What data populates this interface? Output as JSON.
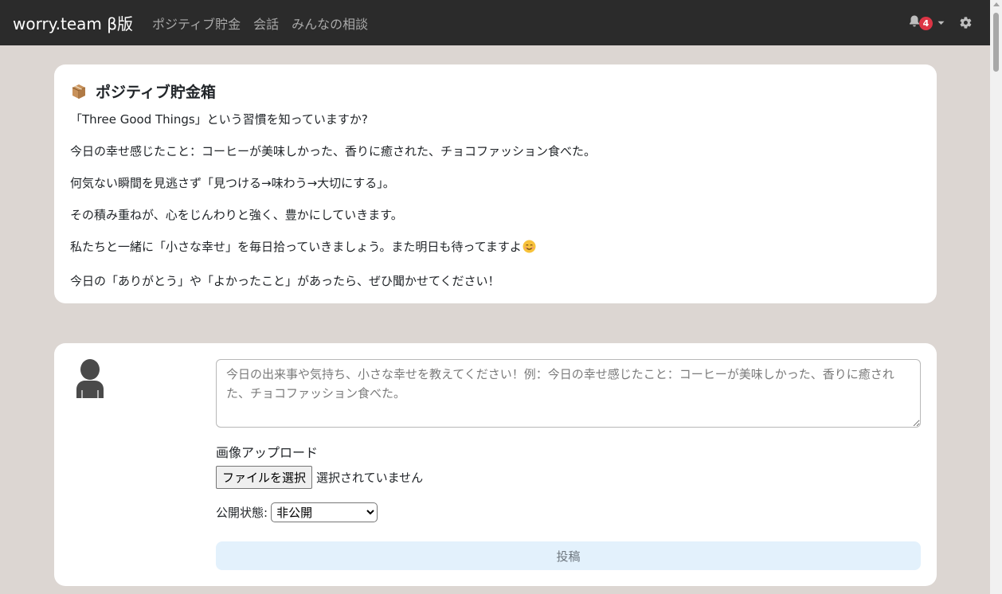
{
  "navbar": {
    "brand": "worry.team β版",
    "links": [
      "ポジティブ貯金",
      "会話",
      "みんなの相談"
    ],
    "notification_count": "4",
    "icons": {
      "bell": "bell-icon",
      "caret": "caret-down-icon",
      "settings": "gear-icon"
    },
    "colors": {
      "background": "#2b2b2b",
      "badge": "#dc3545"
    }
  },
  "intro_card": {
    "title": "ポジティブ貯金箱",
    "title_icon": "package-box-icon",
    "paragraphs": [
      "「Three Good Things」という習慣を知っていますか?",
      "今日の幸せ感じたこと：コーヒーが美味しかった、香りに癒された、チョコファッション食べた。",
      "何気ない瞬間を見逃さず「見つける→味わう→大切にする」。",
      "その積み重ねが、心をじんわりと強く、豊かにしていきます。",
      "私たちと一緒に「小さな幸せ」を毎日拾っていきましょう。また明日も待ってますよ",
      "今日の「ありがとう」や「よかったこと」があったら、ぜひ聞かせてください！"
    ],
    "smile_icon": "smiling-face-icon"
  },
  "post_form": {
    "avatar_icon": "user-avatar-icon",
    "textarea_placeholder": "今日の出来事や気持ち、小さな幸せを教えてください！例：今日の幸せ感じたこと：コーヒーが美味しかった、香りに癒された、チョコファッション食べた。",
    "textarea_value": "",
    "upload_label": "画像アップロード",
    "file_button": "ファイルを選択",
    "file_status": "選択されていません",
    "visibility_label": "公開状態:",
    "visibility_selected": "非公開",
    "submit_label": "投稿",
    "colors": {
      "submit_background": "#e3f1fc",
      "page_background": "#dcd6d2"
    }
  }
}
